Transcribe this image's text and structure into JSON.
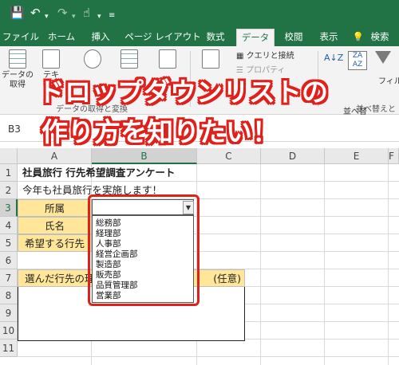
{
  "app": {
    "accent": "#217346",
    "highlight": "#e0211b",
    "cell_fill": "#ffe699"
  },
  "quick_access": [
    "save-icon",
    "undo-icon",
    "redo-icon",
    "touch-mode-icon"
  ],
  "tabs": [
    "ファイル",
    "ホーム",
    "挿入",
    "ページ レイアウト",
    "数式",
    "データ",
    "校閲",
    "表示"
  ],
  "active_tab": "データ",
  "tell_me": "検索",
  "ribbon": {
    "get_data_line1": "データの",
    "get_data_line2": "取得",
    "btn2_line1": "テキ",
    "btn2_line2": "は",
    "group_label": "データの取得と変換",
    "queries_connections": "クエリと接続",
    "properties": "プロパティ",
    "sort": "並べ替",
    "filter": "フィル",
    "sort_filter_group": "並べ替えと"
  },
  "formula_bar": {
    "name_box": "B3"
  },
  "headline": {
    "line1": "ドロップダウンリストの",
    "line2": "作り方を知りたい！"
  },
  "columns": [
    "A",
    "B",
    "C",
    "D",
    "E",
    "F"
  ],
  "rows": [
    "1",
    "2",
    "3",
    "4",
    "5",
    "6",
    "7",
    "8",
    "9",
    "10",
    "11"
  ],
  "cells": {
    "a1": "社員旅行 行先希望調査アンケート",
    "a2": "今年も社員旅行を実施します！",
    "a3": "所属",
    "a4": "氏名",
    "a5": "希望する行先",
    "a7_left": "選んだ行先の理",
    "a7_right": "(任意)"
  },
  "dropdown": {
    "options": [
      "総務部",
      "経理部",
      "人事部",
      "経営企画部",
      "製造部",
      "販売部",
      "品質管理部",
      "営業部"
    ]
  }
}
